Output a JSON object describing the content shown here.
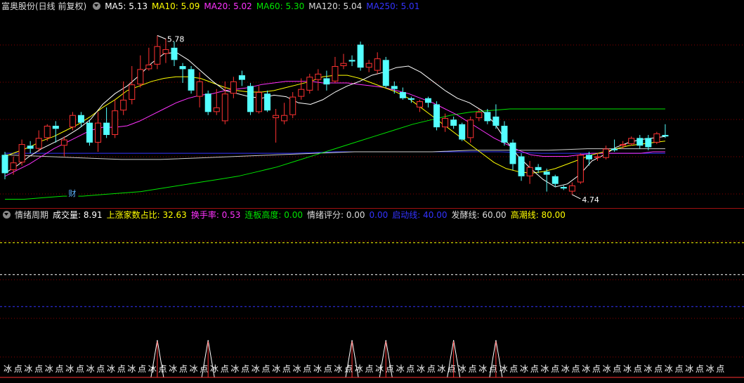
{
  "colors": {
    "up": "#ff3232",
    "down": "#54ffff",
    "ma5": "#ffffff",
    "ma10": "#ffff00",
    "ma20": "#ff33ff",
    "ma60": "#00e600",
    "ma120": "#cccccc",
    "ma250": "#3333ff",
    "grid": "#8b0000"
  },
  "top_legend": {
    "title": "富奥股份(日线 前复权)",
    "ma5": "MA5: 5.13",
    "ma10": "MA10: 5.09",
    "ma20": "MA20: 5.02",
    "ma60": "MA60: 5.30",
    "ma120": "MA120: 5.04",
    "ma250": "MA250: 5.01"
  },
  "bottom_legend": {
    "title": "情绪周期",
    "vol": "成交量: 8.91",
    "up_ratio": "上涨家数占比: 32.63",
    "turnover": "换手率: 0.53",
    "limit_height": "连板高度: 0.00",
    "score": "情绪评分: 0.00",
    "blank": "0.00",
    "startline": "启动线: 40.00",
    "fermline": "发酵线: 60.00",
    "climaxline": "高潮线: 80.00"
  },
  "annotations": {
    "high": "5.78",
    "low": "4.74",
    "cai": "财"
  },
  "chart_data": [
    {
      "type": "candlestick",
      "title": "富奥股份(日线 前复权)",
      "ylim": [
        4.68,
        5.92
      ],
      "candles": [
        {
          "o": 5.0,
          "c": 4.88,
          "h": 5.02,
          "l": 4.84
        },
        {
          "o": 4.9,
          "c": 4.95,
          "h": 4.99,
          "l": 4.87
        },
        {
          "o": 4.95,
          "c": 5.07,
          "h": 5.1,
          "l": 4.93
        },
        {
          "o": 5.06,
          "c": 5.04,
          "h": 5.09,
          "l": 5.01
        },
        {
          "o": 5.04,
          "c": 5.11,
          "h": 5.16,
          "l": 5.02
        },
        {
          "o": 5.11,
          "c": 5.19,
          "h": 5.2,
          "l": 5.09
        },
        {
          "o": 5.19,
          "c": 5.17,
          "h": 5.22,
          "l": 5.08
        },
        {
          "o": 5.06,
          "c": 5.1,
          "h": 5.12,
          "l": 4.99
        },
        {
          "o": 5.18,
          "c": 5.26,
          "h": 5.28,
          "l": 5.16
        },
        {
          "o": 5.26,
          "c": 5.21,
          "h": 5.28,
          "l": 5.18
        },
        {
          "o": 5.21,
          "c": 5.08,
          "h": 5.23,
          "l": 5.06
        },
        {
          "o": 5.08,
          "c": 5.21,
          "h": 5.28,
          "l": 5.02
        },
        {
          "o": 5.21,
          "c": 5.13,
          "h": 5.31,
          "l": 5.11
        },
        {
          "o": 5.13,
          "c": 5.29,
          "h": 5.36,
          "l": 5.11
        },
        {
          "o": 5.29,
          "c": 5.36,
          "h": 5.48,
          "l": 5.26
        },
        {
          "o": 5.36,
          "c": 5.46,
          "h": 5.58,
          "l": 5.33
        },
        {
          "o": 5.46,
          "c": 5.56,
          "h": 5.65,
          "l": 5.44
        },
        {
          "o": 5.56,
          "c": 5.59,
          "h": 5.7,
          "l": 5.55
        },
        {
          "o": 5.59,
          "c": 5.71,
          "h": 5.78,
          "l": 5.56
        },
        {
          "o": 5.66,
          "c": 5.69,
          "h": 5.76,
          "l": 5.6
        },
        {
          "o": 5.7,
          "c": 5.62,
          "h": 5.74,
          "l": 5.58
        },
        {
          "o": 5.58,
          "c": 5.56,
          "h": 5.6,
          "l": 5.47
        },
        {
          "o": 5.56,
          "c": 5.42,
          "h": 5.58,
          "l": 5.4
        },
        {
          "o": 5.38,
          "c": 5.48,
          "h": 5.54,
          "l": 5.31
        },
        {
          "o": 5.4,
          "c": 5.28,
          "h": 5.42,
          "l": 5.26
        },
        {
          "o": 5.28,
          "c": 5.31,
          "h": 5.43,
          "l": 5.26
        },
        {
          "o": 5.22,
          "c": 5.4,
          "h": 5.48,
          "l": 5.2
        },
        {
          "o": 5.4,
          "c": 5.48,
          "h": 5.51,
          "l": 5.37
        },
        {
          "o": 5.52,
          "c": 5.49,
          "h": 5.55,
          "l": 5.45
        },
        {
          "o": 5.45,
          "c": 5.28,
          "h": 5.47,
          "l": 5.26
        },
        {
          "o": 5.28,
          "c": 5.41,
          "h": 5.45,
          "l": 5.27
        },
        {
          "o": 5.4,
          "c": 5.29,
          "h": 5.42,
          "l": 5.28
        },
        {
          "o": 5.24,
          "c": 5.26,
          "h": 5.3,
          "l": 5.08
        },
        {
          "o": 5.22,
          "c": 5.26,
          "h": 5.34,
          "l": 5.2
        },
        {
          "o": 5.26,
          "c": 5.38,
          "h": 5.41,
          "l": 5.24
        },
        {
          "o": 5.38,
          "c": 5.43,
          "h": 5.5,
          "l": 5.36
        },
        {
          "o": 5.42,
          "c": 5.51,
          "h": 5.53,
          "l": 5.4
        },
        {
          "o": 5.49,
          "c": 5.53,
          "h": 5.56,
          "l": 5.42
        },
        {
          "o": 5.5,
          "c": 5.46,
          "h": 5.55,
          "l": 5.42
        },
        {
          "o": 5.48,
          "c": 5.58,
          "h": 5.64,
          "l": 5.47
        },
        {
          "o": 5.58,
          "c": 5.6,
          "h": 5.66,
          "l": 5.56
        },
        {
          "o": 5.62,
          "c": 5.61,
          "h": 5.65,
          "l": 5.58
        },
        {
          "o": 5.72,
          "c": 5.57,
          "h": 5.74,
          "l": 5.55
        },
        {
          "o": 5.57,
          "c": 5.6,
          "h": 5.62,
          "l": 5.54
        },
        {
          "o": 5.55,
          "c": 5.63,
          "h": 5.67,
          "l": 5.53
        },
        {
          "o": 5.62,
          "c": 5.45,
          "h": 5.64,
          "l": 5.44
        },
        {
          "o": 5.45,
          "c": 5.43,
          "h": 5.48,
          "l": 5.4
        },
        {
          "o": 5.41,
          "c": 5.37,
          "h": 5.44,
          "l": 5.36
        },
        {
          "o": 5.37,
          "c": 5.36,
          "h": 5.38,
          "l": 5.34
        },
        {
          "o": 5.31,
          "c": 5.35,
          "h": 5.36,
          "l": 5.28
        },
        {
          "o": 5.37,
          "c": 5.34,
          "h": 5.38,
          "l": 5.31
        },
        {
          "o": 5.33,
          "c": 5.18,
          "h": 5.35,
          "l": 5.16
        },
        {
          "o": 5.18,
          "c": 5.24,
          "h": 5.27,
          "l": 5.15
        },
        {
          "o": 5.23,
          "c": 5.19,
          "h": 5.25,
          "l": 5.17
        },
        {
          "o": 5.2,
          "c": 5.1,
          "h": 5.21,
          "l": 5.09
        },
        {
          "o": 5.11,
          "c": 5.23,
          "h": 5.25,
          "l": 5.08
        },
        {
          "o": 5.24,
          "c": 5.28,
          "h": 5.3,
          "l": 5.22
        },
        {
          "o": 5.28,
          "c": 5.22,
          "h": 5.3,
          "l": 5.2
        },
        {
          "o": 5.25,
          "c": 5.19,
          "h": 5.33,
          "l": 5.17
        },
        {
          "o": 5.19,
          "c": 5.08,
          "h": 5.22,
          "l": 5.06
        },
        {
          "o": 5.08,
          "c": 4.94,
          "h": 5.1,
          "l": 4.9
        },
        {
          "o": 4.99,
          "c": 4.86,
          "h": 5.01,
          "l": 4.83
        },
        {
          "o": 4.86,
          "c": 4.92,
          "h": 4.96,
          "l": 4.81
        },
        {
          "o": 4.92,
          "c": 4.9,
          "h": 4.94,
          "l": 4.88
        },
        {
          "o": 4.89,
          "c": 4.87,
          "h": 4.91,
          "l": 4.76
        },
        {
          "o": 4.86,
          "c": 4.81,
          "h": 4.87,
          "l": 4.79
        },
        {
          "o": 4.79,
          "c": 4.78,
          "h": 4.8,
          "l": 4.77
        },
        {
          "o": 4.76,
          "c": 4.8,
          "h": 4.82,
          "l": 4.74
        },
        {
          "o": 4.82,
          "c": 5.0,
          "h": 5.01,
          "l": 4.81
        },
        {
          "o": 5.0,
          "c": 4.97,
          "h": 5.02,
          "l": 4.93
        },
        {
          "o": 4.98,
          "c": 4.99,
          "h": 5.01,
          "l": 4.96
        },
        {
          "o": 4.98,
          "c": 5.04,
          "h": 5.06,
          "l": 4.97
        },
        {
          "o": 5.04,
          "c": 5.03,
          "h": 5.1,
          "l": 5.02
        },
        {
          "o": 5.06,
          "c": 5.07,
          "h": 5.09,
          "l": 5.04
        },
        {
          "o": 5.07,
          "c": 5.11,
          "h": 5.12,
          "l": 5.06
        },
        {
          "o": 5.11,
          "c": 5.06,
          "h": 5.13,
          "l": 5.04
        },
        {
          "o": 5.11,
          "c": 5.05,
          "h": 5.13,
          "l": 5.03
        },
        {
          "o": 5.08,
          "c": 5.14,
          "h": 5.15,
          "l": 5.07
        },
        {
          "o": 5.13,
          "c": 5.12,
          "h": 5.2,
          "l": 5.11
        }
      ],
      "ma5": [
        4.88,
        4.93,
        4.99,
        5.04,
        5.08,
        5.12,
        5.17,
        5.23,
        5.33,
        5.4,
        5.45,
        5.52,
        5.6,
        5.66,
        5.67,
        5.62,
        5.55,
        5.48,
        5.42,
        5.4,
        5.38,
        5.37,
        5.39,
        5.38,
        5.34,
        5.33,
        5.36,
        5.41,
        5.45,
        5.48,
        5.52,
        5.54,
        5.57,
        5.58,
        5.54,
        5.48,
        5.42,
        5.37,
        5.34,
        5.29,
        5.21,
        5.09,
        4.99,
        4.91,
        4.84,
        4.79,
        4.81,
        4.87,
        4.96,
        5.0,
        5.05,
        5.08,
        5.1,
        5.11,
        5.12
      ],
      "ma10": [
        4.99,
        5.02,
        5.05,
        5.09,
        5.12,
        5.16,
        5.2,
        5.25,
        5.31,
        5.36,
        5.42,
        5.45,
        5.48,
        5.5,
        5.51,
        5.51,
        5.5,
        5.47,
        5.44,
        5.42,
        5.41,
        5.41,
        5.42,
        5.44,
        5.46,
        5.48,
        5.51,
        5.52,
        5.52,
        5.5,
        5.47,
        5.44,
        5.41,
        5.37,
        5.31,
        5.25,
        5.19,
        5.13,
        5.07,
        5.01,
        4.95,
        4.91,
        4.89,
        4.88,
        4.89,
        4.91,
        4.94,
        4.97,
        5.0,
        5.02,
        5.04,
        5.06,
        5.07,
        5.08,
        5.09
      ],
      "ma20": [
        4.86,
        4.9,
        4.94,
        4.99,
        5.04,
        5.08,
        5.12,
        5.16,
        5.18,
        5.18,
        5.19,
        5.22,
        5.26,
        5.3,
        5.34,
        5.37,
        5.39,
        5.4,
        5.42,
        5.43,
        5.44,
        5.46,
        5.47,
        5.48,
        5.48,
        5.48,
        5.47,
        5.47,
        5.47,
        5.46,
        5.45,
        5.44,
        5.42,
        5.4,
        5.37,
        5.34,
        5.3,
        5.26,
        5.21,
        5.16,
        5.11,
        5.07,
        5.03,
        5.0,
        4.99,
        4.99,
        4.99,
        5.0,
        5.01,
        5.01,
        5.01,
        5.01,
        5.01,
        5.02,
        5.02
      ],
      "ma60": [
        4.71,
        4.71,
        4.72,
        4.73,
        4.73,
        4.74,
        4.75,
        4.76,
        4.78,
        4.8,
        4.82,
        4.84,
        4.86,
        4.89,
        4.92,
        4.96,
        5.0,
        5.04,
        5.08,
        5.12,
        5.16,
        5.2,
        5.23,
        5.26,
        5.28,
        5.29,
        5.3,
        5.3,
        5.3,
        5.3,
        5.3,
        5.3,
        5.3,
        5.3,
        5.3
      ],
      "ma120": [
        5.0,
        4.99,
        4.98,
        4.97,
        4.97,
        4.98,
        4.99,
        5.0,
        5.01,
        5.02,
        5.02,
        5.02,
        5.03,
        5.03,
        5.03,
        5.04,
        5.04,
        5.04
      ],
      "ma250": [
        5.01,
        5.01,
        5.01,
        5.01,
        5.01,
        5.01,
        5.01,
        5.01,
        5.02,
        5.02,
        5.02,
        5.02,
        5.02,
        5.01,
        5.01,
        5.01,
        5.01
      ]
    },
    {
      "type": "line",
      "title": "情绪周期",
      "ylim": [
        0,
        100
      ],
      "levels": [
        80,
        60,
        40
      ],
      "spikes": [
        18,
        24,
        41,
        45,
        53,
        58
      ],
      "mark_labels": [
        "冰",
        "点",
        "冰",
        "点",
        "冰",
        "点",
        "冰",
        "点",
        "冰",
        "点",
        "冰",
        "点",
        "冰",
        "点",
        "冰",
        "点",
        "冰",
        "点",
        "冰",
        "点",
        "冰",
        "点",
        "冰",
        "点",
        "冰",
        "点",
        "冰",
        "点",
        "冰",
        "点",
        "冰",
        "点",
        "冰",
        "点",
        "冰",
        "点",
        "冰",
        "点",
        "冰",
        "点",
        "冰",
        "点",
        "冰",
        "点",
        "冰",
        "点",
        "冰",
        "点",
        "冰",
        "点",
        "冰",
        "点",
        "冰",
        "点",
        "冰",
        "点",
        "冰",
        "点",
        "冰",
        "点",
        "冰",
        "点",
        "冰",
        "点",
        "冰",
        "点",
        "冰",
        "点",
        "冰",
        "点"
      ]
    }
  ]
}
